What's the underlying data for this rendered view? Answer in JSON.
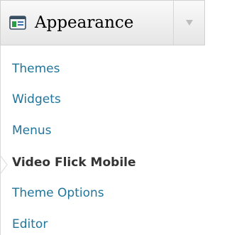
{
  "menu": {
    "title": "Appearance",
    "icon": "appearance-icon",
    "toggle_icon": "arrow-down-icon",
    "submenu": [
      {
        "label": "Themes"
      },
      {
        "label": "Widgets"
      },
      {
        "label": "Menus"
      },
      {
        "label": "Video Flick Mobile",
        "current": true
      },
      {
        "label": "Theme Options"
      },
      {
        "label": "Editor"
      }
    ]
  },
  "colors": {
    "link": "#21759b",
    "current_text": "#333333",
    "header_gradient_top": "#f9f9f9",
    "header_gradient_bottom": "#e6e6e6",
    "border": "#d1d1d1"
  }
}
